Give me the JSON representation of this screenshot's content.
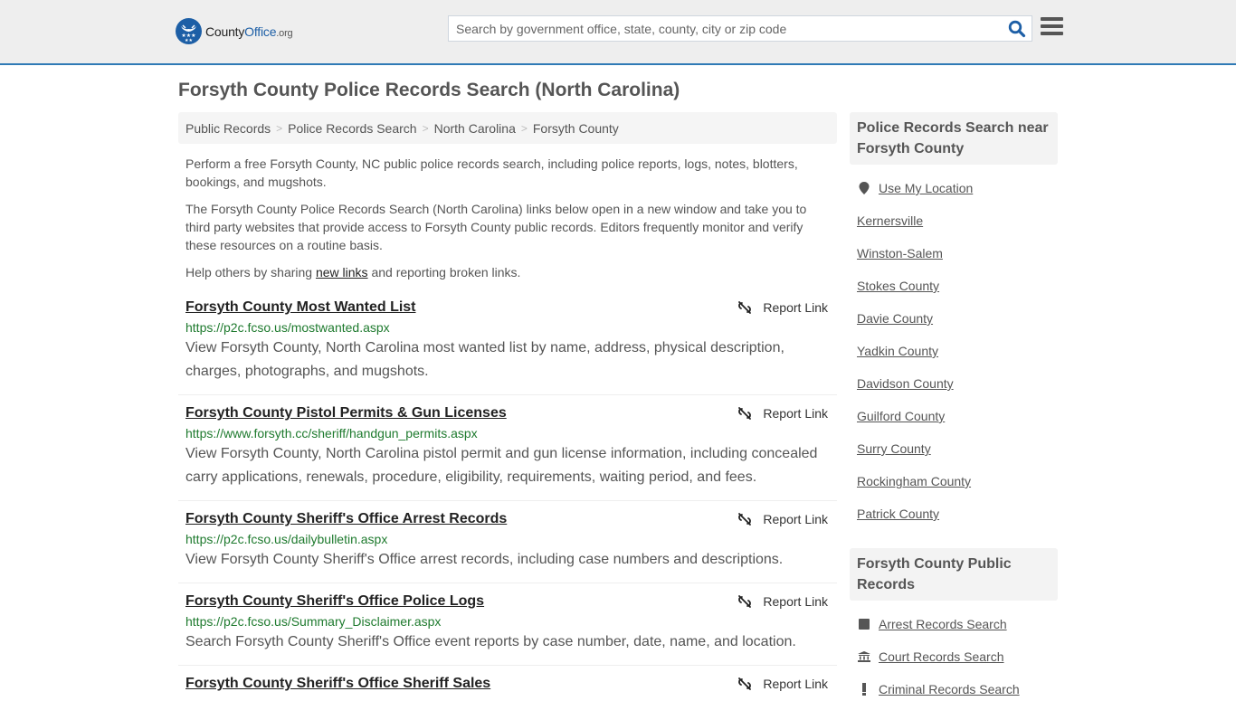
{
  "header": {
    "logo": {
      "brand_county": "County",
      "brand_office": "Office",
      "brand_tld": ".org"
    },
    "search": {
      "placeholder": "Search by government office, state, county, city or zip code",
      "value": "",
      "icon": "search-icon"
    },
    "menu_icon": "hamburger-menu-icon"
  },
  "page": {
    "title": "Forsyth County Police Records Search (North Carolina)"
  },
  "breadcrumb": [
    {
      "label": "Public Records"
    },
    {
      "label": "Police Records Search"
    },
    {
      "label": "North Carolina"
    },
    {
      "label": "Forsyth County"
    }
  ],
  "intro": {
    "p1": "Perform a free Forsyth County, NC public police records search, including police reports, logs, notes, blotters, bookings, and mugshots.",
    "p2": "The Forsyth County Police Records Search (North Carolina) links below open in a new window and take you to third party websites that provide access to Forsyth County public records. Editors frequently monitor and verify these resources on a routine basis.",
    "p3_before": "Help others by sharing ",
    "p3_link": "new links",
    "p3_after": " and reporting broken links."
  },
  "report_label": "Report Link",
  "results": [
    {
      "title": "Forsyth County Most Wanted List",
      "url": "https://p2c.fcso.us/mostwanted.aspx",
      "desc": "View Forsyth County, North Carolina most wanted list by name, address, physical description, charges, photographs, and mugshots."
    },
    {
      "title": "Forsyth County Pistol Permits & Gun Licenses",
      "url": "https://www.forsyth.cc/sheriff/handgun_permits.aspx",
      "desc": "View Forsyth County, North Carolina pistol permit and gun license information, including concealed carry applications, renewals, procedure, eligibility, requirements, waiting period, and fees."
    },
    {
      "title": "Forsyth County Sheriff's Office Arrest Records",
      "url": "https://p2c.fcso.us/dailybulletin.aspx",
      "desc": "View Forsyth County Sheriff's Office arrest records, including case numbers and descriptions."
    },
    {
      "title": "Forsyth County Sheriff's Office Police Logs",
      "url": "https://p2c.fcso.us/Summary_Disclaimer.aspx",
      "desc": "Search Forsyth County Sheriff's Office event reports by case number, date, name, and location."
    },
    {
      "title": "Forsyth County Sheriff's Office Sheriff Sales",
      "url": "",
      "desc": ""
    }
  ],
  "sidebar": {
    "nearby": {
      "heading": "Police Records Search near Forsyth County",
      "use_location": "Use My Location",
      "links": [
        "Kernersville",
        "Winston-Salem",
        "Stokes County",
        "Davie County",
        "Yadkin County",
        "Davidson County",
        "Guilford County",
        "Surry County",
        "Rockingham County",
        "Patrick County"
      ]
    },
    "public_records": {
      "heading": "Forsyth County Public Records",
      "links": [
        {
          "label": "Arrest Records Search",
          "icon": "square-icon"
        },
        {
          "label": "Court Records Search",
          "icon": "courthouse-icon"
        },
        {
          "label": "Criminal Records Search",
          "icon": "exclamation-icon"
        }
      ]
    }
  },
  "colors": {
    "accent": "#2f7ab5",
    "brand": "#1d5fa6",
    "url_green": "#1e7a2e",
    "header_bg": "#eeeeee"
  }
}
